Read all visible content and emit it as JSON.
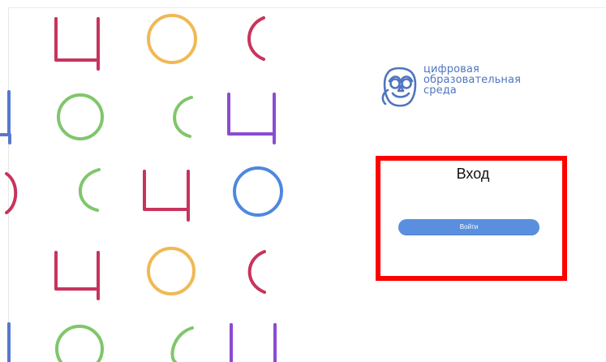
{
  "decorative_pattern": {
    "rows": [
      {
        "items": [
          {
            "letter": "Ц",
            "color": "#c7345c"
          },
          {
            "letter": "О",
            "color": "#f0b955"
          },
          {
            "letter": "С",
            "color": "#c7345c"
          }
        ]
      },
      {
        "items": [
          {
            "letter": "Ц",
            "color": "#5678ce"
          },
          {
            "letter": "О",
            "color": "#80c66b"
          },
          {
            "letter": "С",
            "color": "#80c66b"
          },
          {
            "letter": "Ц",
            "color": "#8b4bd2"
          }
        ]
      },
      {
        "items": [
          {
            "letter": "О",
            "color": "#c7345c"
          },
          {
            "letter": "С",
            "color": "#80c66b"
          },
          {
            "letter": "Ц",
            "color": "#c7345c"
          },
          {
            "letter": "О",
            "color": "#4d88df"
          }
        ]
      },
      {
        "items": [
          {
            "letter": "Ц",
            "color": "#c7345c"
          },
          {
            "letter": "О",
            "color": "#f0b955"
          },
          {
            "letter": "С",
            "color": "#c7345c"
          }
        ]
      },
      {
        "items": [
          {
            "letter": "Ц",
            "color": "#5678ce"
          },
          {
            "letter": "О",
            "color": "#80c66b"
          },
          {
            "letter": "С",
            "color": "#80c66b"
          },
          {
            "letter": "Ц",
            "color": "#8b4bd2"
          }
        ]
      }
    ]
  },
  "brand": {
    "lines": [
      "цифровая",
      "образовательная",
      "среда"
    ],
    "icon": "owl-logo-icon",
    "color": "#4f75bf"
  },
  "login": {
    "title": "Вход",
    "button_label": "Войти",
    "button_color": "#5a8fe0",
    "highlight_color": "#ff0000"
  }
}
